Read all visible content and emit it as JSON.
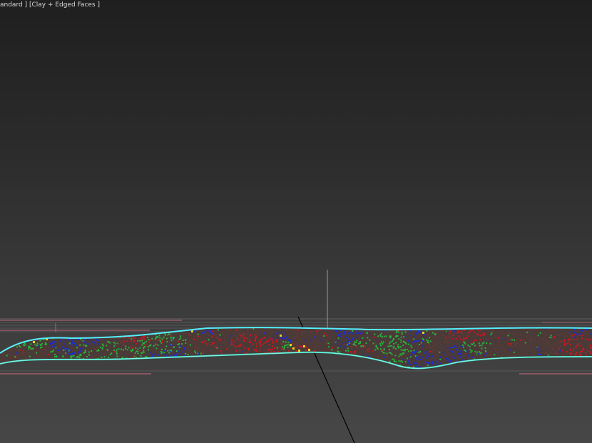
{
  "viewport": {
    "label_shading_mode": "andard ]",
    "label_display_mode": "[Clay + Edged Faces ]",
    "colors": {
      "background_top": "#1f1f1f",
      "background_bottom": "#474747",
      "spline": "#55f0ff",
      "spline_bottom": "#3de6c0",
      "grid_line": "#8a8a8a",
      "accent_line": "#e0708a",
      "points": [
        "#d0141e",
        "#1a2cd8",
        "#22b83a",
        "#5a3a36",
        "#e8d21e"
      ]
    }
  }
}
